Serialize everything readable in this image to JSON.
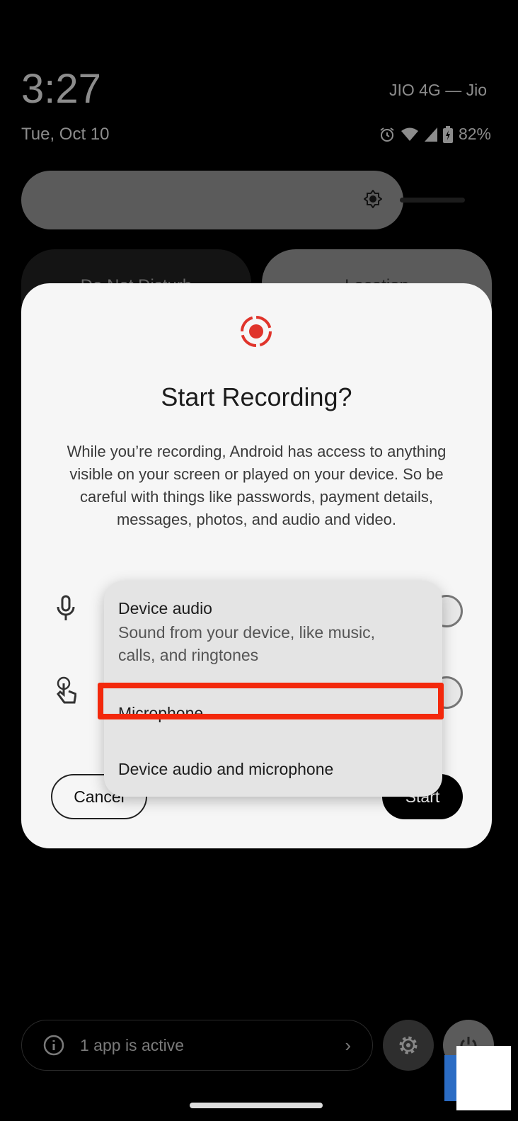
{
  "status_bar": {
    "time": "3:27",
    "date": "Tue, Oct 10",
    "carrier": "JIO 4G — Jio",
    "battery": "82%"
  },
  "tiles": [
    {
      "label": "Do Not Disturb"
    },
    {
      "label": "Location"
    }
  ],
  "dialog": {
    "title": "Start Recording?",
    "body": "While you’re recording, Android has access to anything visible on your screen or played on your device. So be careful with things like passwords, payment details, messages, photos, and audio and video.",
    "cancel_label": "Cancel",
    "start_label": "Start",
    "accent": "#e0342b"
  },
  "audio_menu": {
    "options": [
      {
        "label": "Device audio",
        "description": "Sound from your device, like music, calls, and ringtones"
      },
      {
        "label": "Microphone",
        "highlighted": true
      },
      {
        "label": "Device audio and microphone"
      }
    ],
    "highlight_color": "#f3280c"
  },
  "footer": {
    "active_apps": "1 app is active"
  }
}
